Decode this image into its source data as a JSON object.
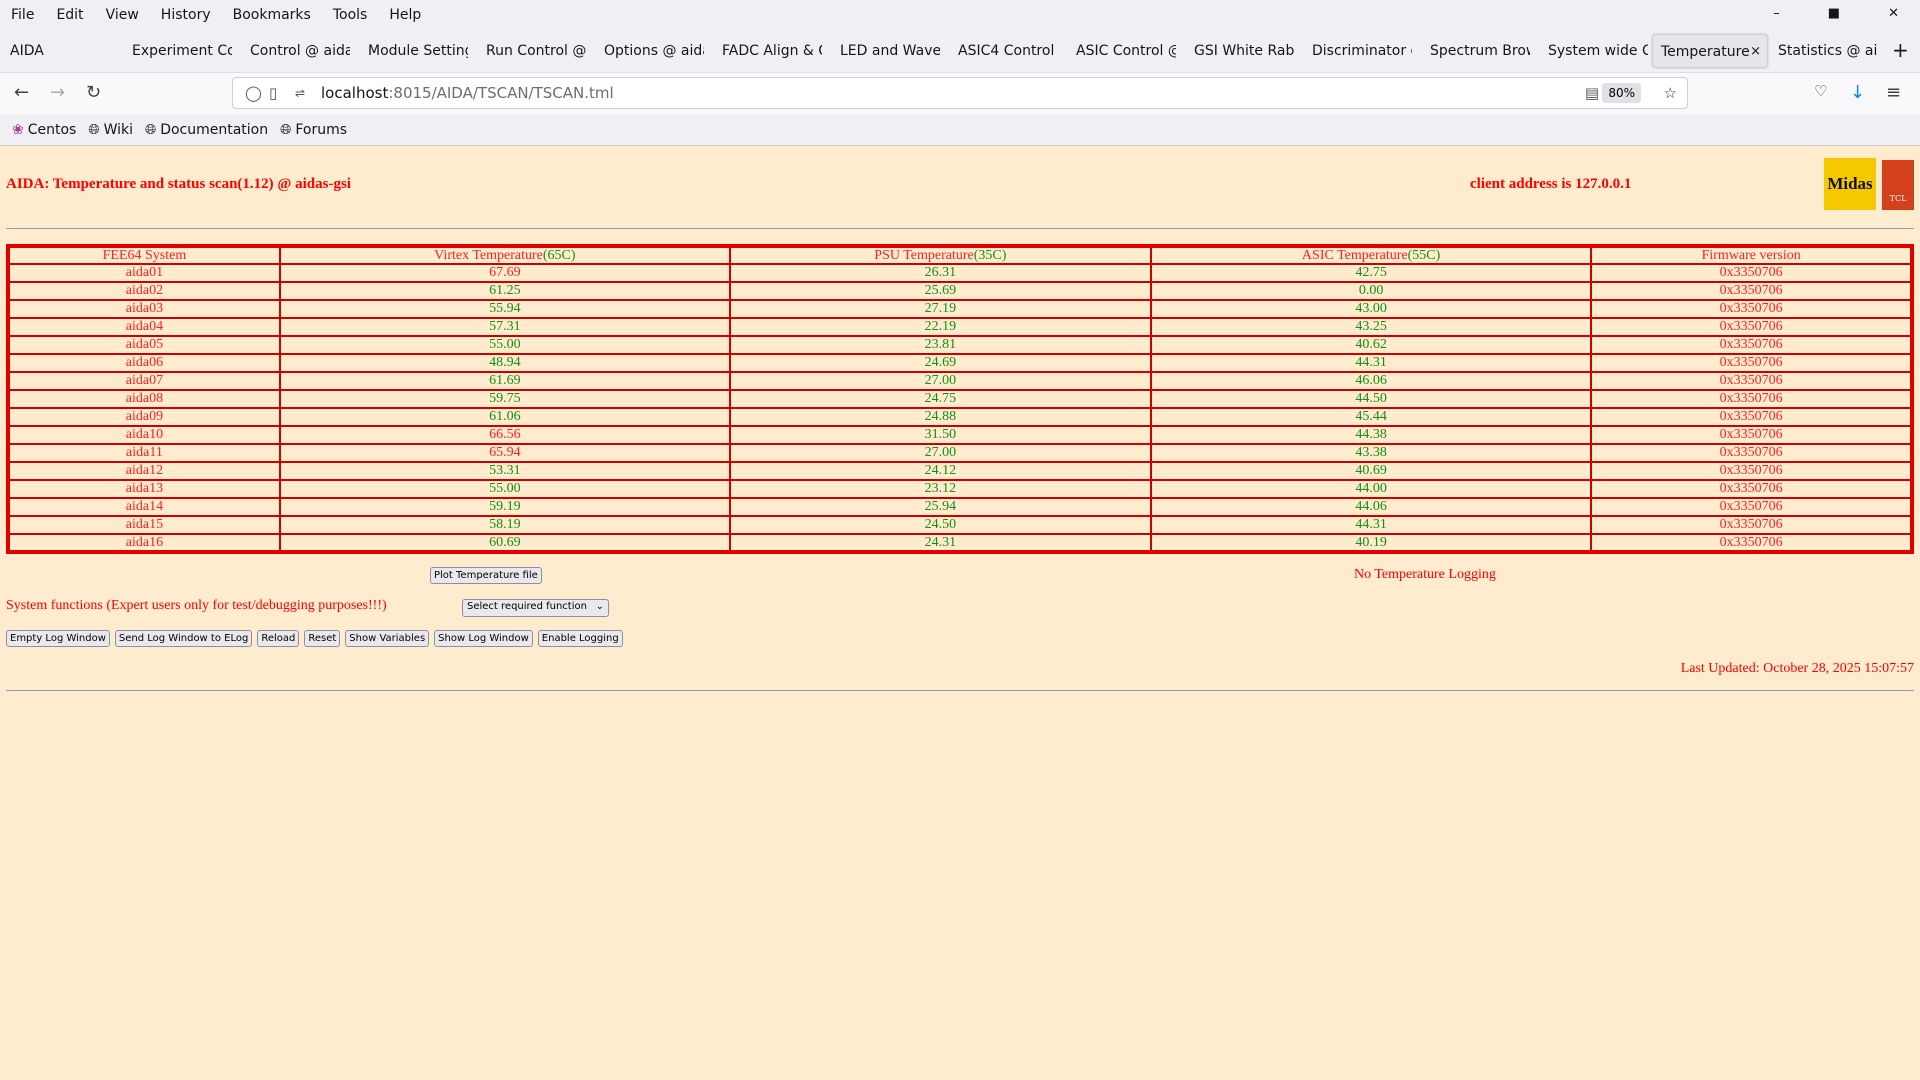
{
  "browser": {
    "menu": [
      "File",
      "Edit",
      "View",
      "History",
      "Bookmarks",
      "Tools",
      "Help"
    ],
    "tabs": [
      "AIDA",
      "Experiment Co",
      "Control @ aida",
      "Module Setting",
      "Run Control @",
      "Options @ aida",
      "FADC Align & C",
      "LED and Wavef",
      "ASIC4 Control",
      "ASIC Control @",
      "GSI White Rabb",
      "Discriminator c",
      "Spectrum Brow",
      "System wide C",
      "Temperature",
      "Statistics @ ai"
    ],
    "active_tab": 14,
    "url_host": "localhost",
    "url_path": ":8015/AIDA/TSCAN/TSCAN.tml",
    "zoom": "80%",
    "bookmarks": [
      "Centos",
      "Wiki",
      "Documentation",
      "Forums"
    ]
  },
  "page": {
    "title": "AIDA: Temperature and status scan(1.12) @ aidas-gsi",
    "client": "client address is 127.0.0.1",
    "logo_text": "Midas",
    "logo2_text": "TCL"
  },
  "table": {
    "headers": [
      {
        "label": "FEE64 System",
        "limit": ""
      },
      {
        "label": "Virtex Temperature",
        "limit": "(65C)"
      },
      {
        "label": "PSU Temperature",
        "limit": "(35C)"
      },
      {
        "label": "ASIC Temperature",
        "limit": "(55C)"
      },
      {
        "label": "Firmware version",
        "limit": ""
      }
    ],
    "limits": [
      null,
      65,
      35,
      55,
      null
    ],
    "rows": [
      [
        "aida01",
        "67.69",
        "26.31",
        "42.75",
        "0x3350706"
      ],
      [
        "aida02",
        "61.25",
        "25.69",
        "0.00",
        "0x3350706"
      ],
      [
        "aida03",
        "55.94",
        "27.19",
        "43.00",
        "0x3350706"
      ],
      [
        "aida04",
        "57.31",
        "22.19",
        "43.25",
        "0x3350706"
      ],
      [
        "aida05",
        "55.00",
        "23.81",
        "40.62",
        "0x3350706"
      ],
      [
        "aida06",
        "48.94",
        "24.69",
        "44.31",
        "0x3350706"
      ],
      [
        "aida07",
        "61.69",
        "27.00",
        "46.06",
        "0x3350706"
      ],
      [
        "aida08",
        "59.75",
        "24.75",
        "44.50",
        "0x3350706"
      ],
      [
        "aida09",
        "61.06",
        "24.88",
        "45.44",
        "0x3350706"
      ],
      [
        "aida10",
        "66.56",
        "31.50",
        "44.38",
        "0x3350706"
      ],
      [
        "aida11",
        "65.94",
        "27.00",
        "43.38",
        "0x3350706"
      ],
      [
        "aida12",
        "53.31",
        "24.12",
        "40.69",
        "0x3350706"
      ],
      [
        "aida13",
        "55.00",
        "23.12",
        "44.00",
        "0x3350706"
      ],
      [
        "aida14",
        "59.19",
        "25.94",
        "44.06",
        "0x3350706"
      ],
      [
        "aida15",
        "58.19",
        "24.50",
        "44.31",
        "0x3350706"
      ],
      [
        "aida16",
        "60.69",
        "24.31",
        "40.19",
        "0x3350706"
      ]
    ]
  },
  "controls": {
    "plot_button": "Plot Temperature file",
    "logging_status": "No Temperature Logging",
    "system_functions_label": "System functions (Expert users only for test/debugging purposes!!!)",
    "select_value": "Select required function",
    "buttons": [
      "Empty Log Window",
      "Send Log Window to ELog",
      "Reload",
      "Reset",
      "Show Variables",
      "Show Log Window",
      "Enable Logging"
    ],
    "last_updated": "Last Updated: October 28, 2025 15:07:57"
  },
  "colors": {
    "background": "#ffebcd",
    "alert": "#ff0000",
    "ok": "#119011",
    "border": "#d00000"
  }
}
